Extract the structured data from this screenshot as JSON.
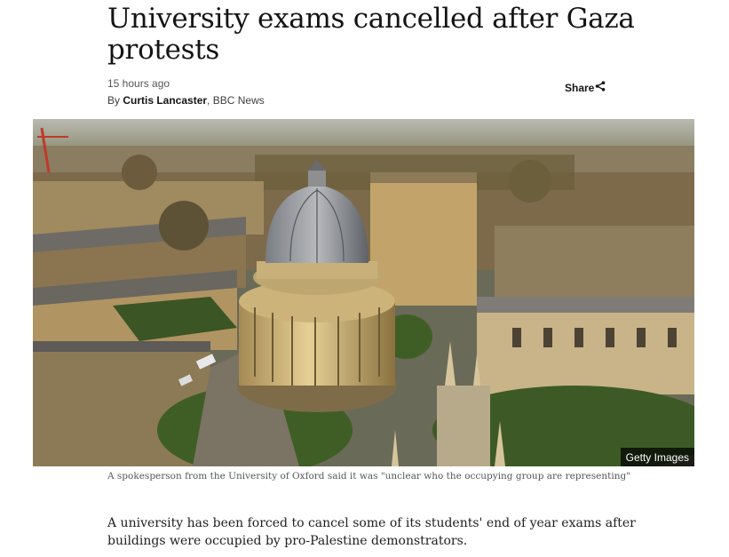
{
  "article": {
    "headline": "University exams cancelled after Gaza protests",
    "timestamp": "15 hours ago",
    "byline_prefix": "By ",
    "author": "Curtis Lancaster",
    "byline_source": ", BBC News",
    "share_label": "Share",
    "share_icon": "share-icon",
    "image_credit": "Getty Images",
    "image_caption": "A spokesperson from the University of Oxford said it was \"unclear who the occupying group are representing\"",
    "lede": "A university has been forced to cancel some of its students' end of year exams after buildings were occupied by pro-Palestine demonstrators."
  }
}
